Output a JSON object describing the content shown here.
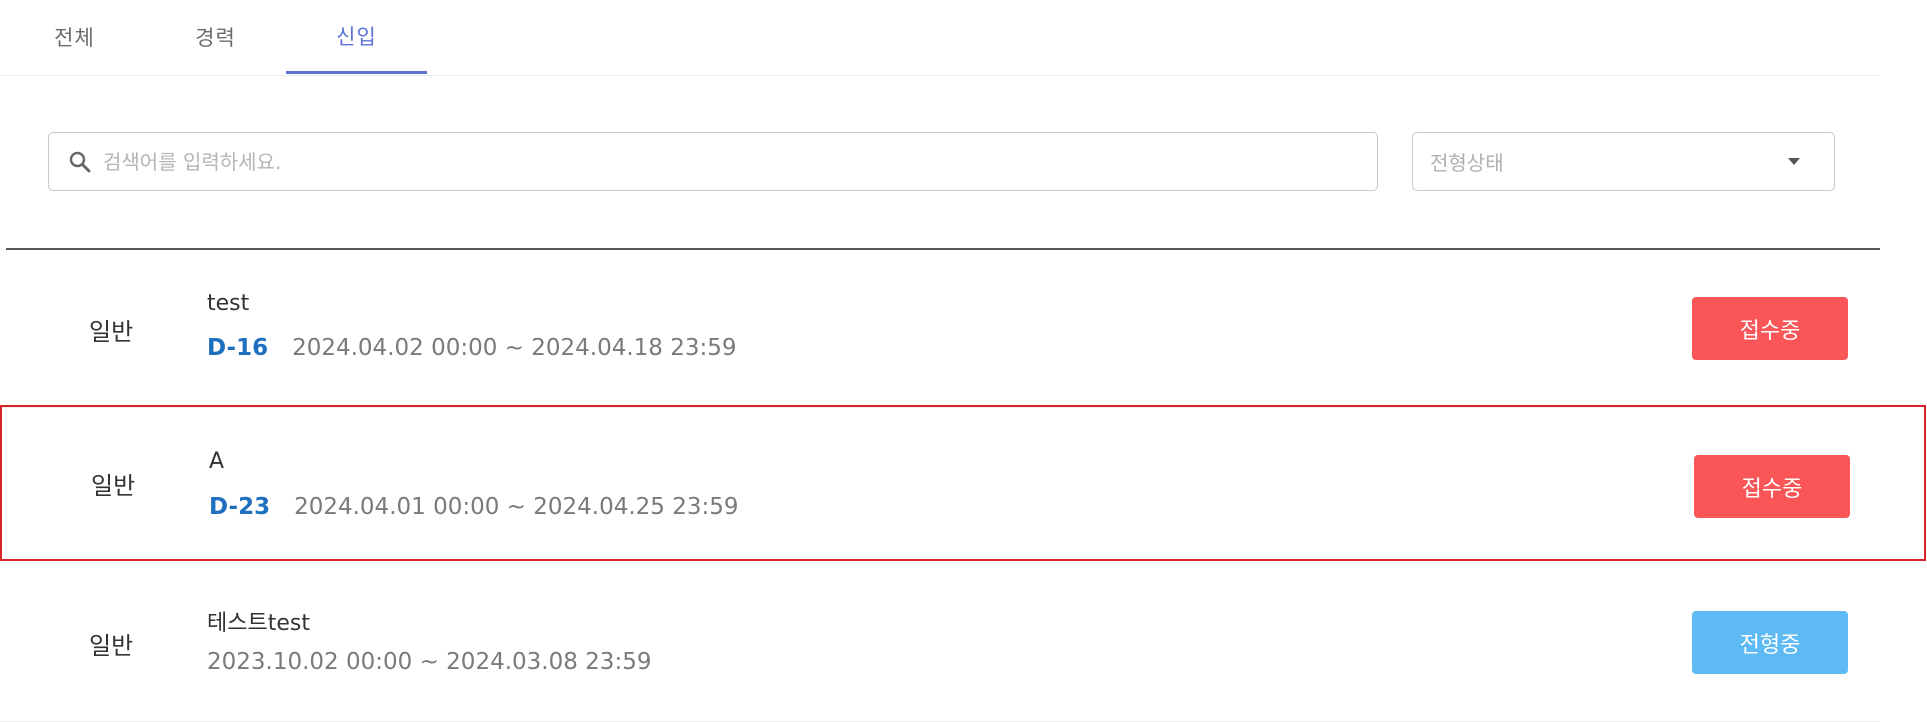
{
  "tabs": [
    {
      "label": "전체",
      "active": false
    },
    {
      "label": "경력",
      "active": false
    },
    {
      "label": "신입",
      "active": true
    }
  ],
  "search": {
    "placeholder": "검색어를 입력하세요.",
    "value": ""
  },
  "filter": {
    "selected": "전형상태"
  },
  "postings": [
    {
      "category": "일반",
      "title": "test",
      "dday": "D-16",
      "period": "2024.04.02 00:00 ~ 2024.04.18 23:59",
      "status": "접수중"
    },
    {
      "category": "일반",
      "title": "A",
      "dday": "D-23",
      "period": "2024.04.01 00:00 ~ 2024.04.25 23:59",
      "status": "접수중"
    },
    {
      "category": "일반",
      "title": "테스트test",
      "dday": "",
      "period": "2023.10.02 00:00 ~ 2024.03.08 23:59",
      "status": "전형중"
    }
  ],
  "colors": {
    "accent": "#5b73d6",
    "dday": "#1f6fc0",
    "status_receiving": "#fa5557",
    "status_screening": "#5dbaf5",
    "highlight_border": "#d9232a"
  }
}
